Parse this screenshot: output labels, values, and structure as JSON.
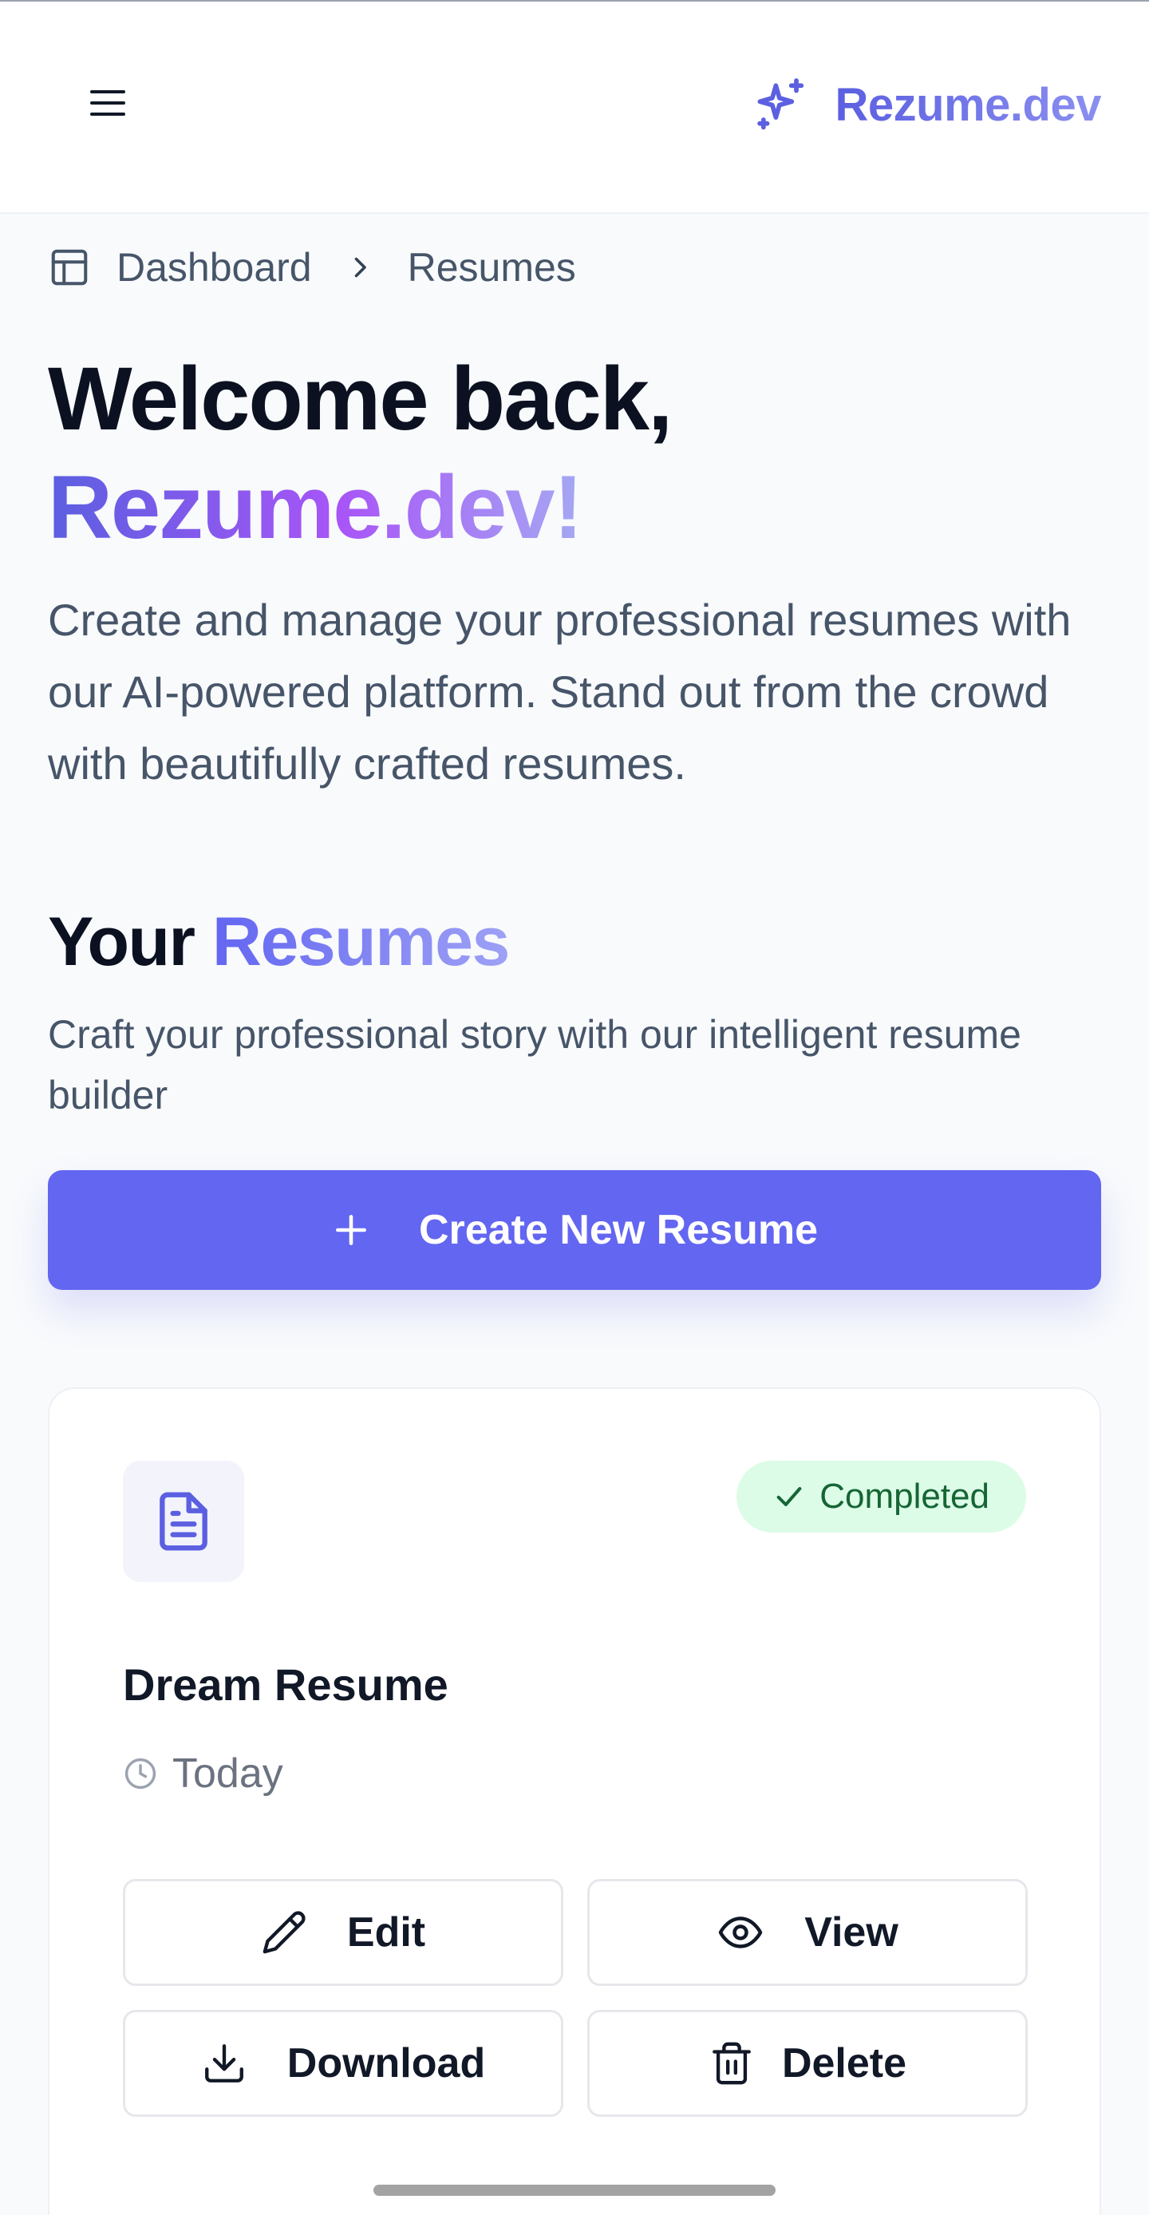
{
  "header": {
    "brand_name": "Rezume.dev",
    "menu_icon": "hamburger-menu-icon",
    "brand_icon": "sparkles-icon",
    "brand_color": "#5b5fe0"
  },
  "breadcrumb": {
    "home_label": "Dashboard",
    "home_icon": "layout-icon",
    "separator_icon": "chevron-right-icon",
    "current_label": "Resumes"
  },
  "hero": {
    "title_line1": "Welcome back,",
    "title_brand": "Rezume.dev!",
    "description": "Create and manage your professional resumes with our AI-powered platform. Stand out from the crowd with beautifully crafted resumes."
  },
  "resumes_section": {
    "title_prefix": "Your",
    "title_accent": "Resumes",
    "subtitle": "Craft your professional story with our intelligent resume builder",
    "create_button_label": "Create New Resume",
    "create_button_icon": "plus-icon",
    "accent_color": "#6366f1"
  },
  "resume_card": {
    "doc_icon": "file-text-icon",
    "status": "Completed",
    "status_icon": "check-icon",
    "status_color": "#166534",
    "name": "Dream Resume",
    "updated": "Today",
    "updated_icon": "clock-icon",
    "actions": {
      "edit": "Edit",
      "view": "View",
      "download": "Download",
      "delete": "Delete"
    }
  }
}
